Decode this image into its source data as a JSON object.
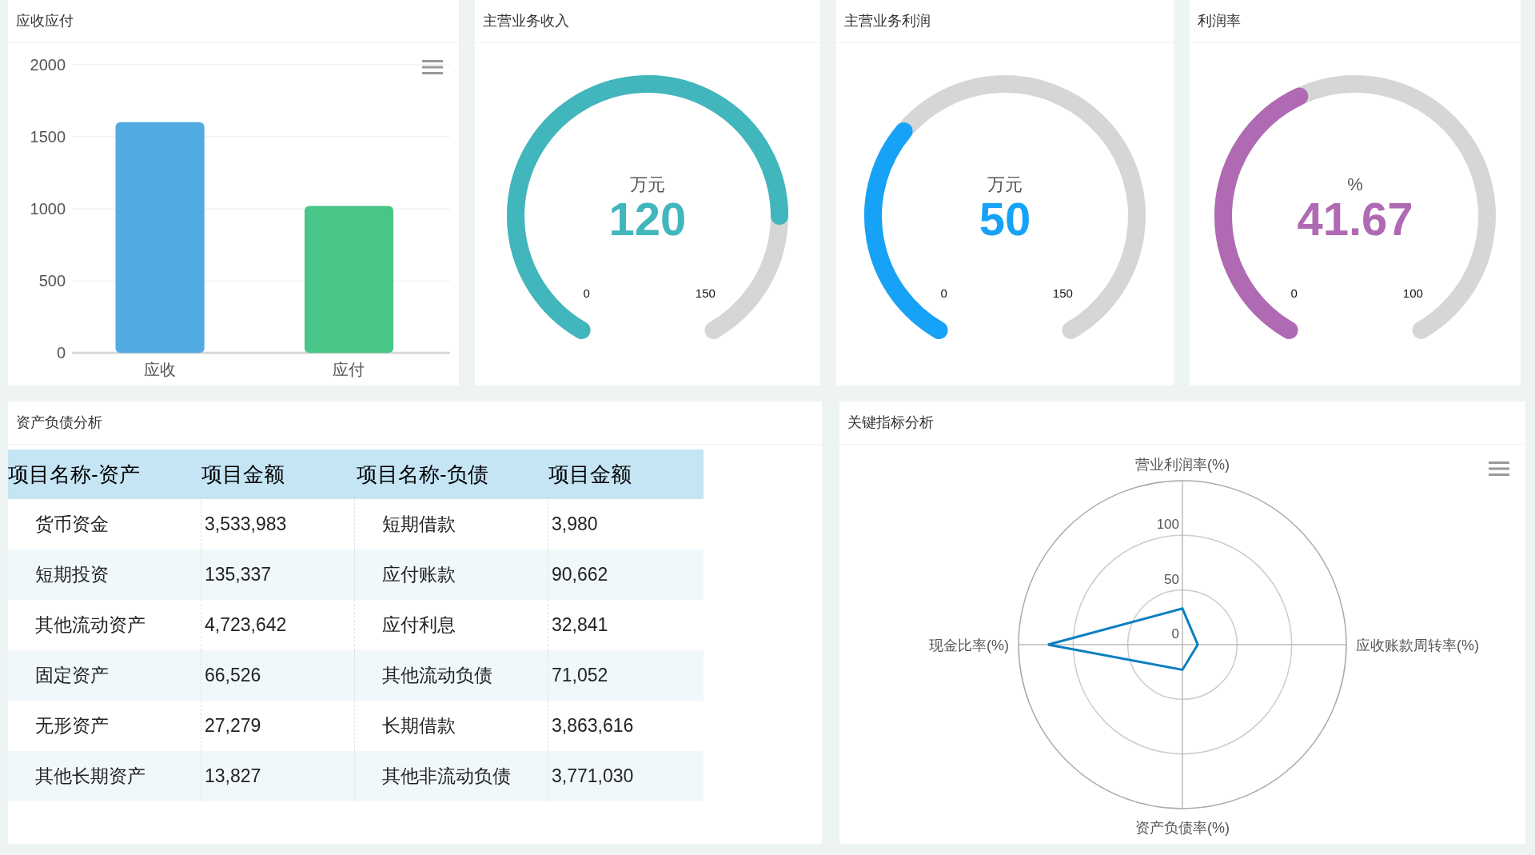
{
  "receivables_card": {
    "title": "应收应付",
    "chart_data": {
      "type": "bar",
      "categories": [
        "应收",
        "应付"
      ],
      "values": [
        1600,
        1020
      ],
      "ylim": [
        0,
        2000
      ],
      "yticks": [
        0,
        500,
        1000,
        1500,
        2000
      ],
      "grid": true
    }
  },
  "gauges": [
    {
      "title": "主营业务收入",
      "unit": "万元",
      "value": "120",
      "min_label": "0",
      "max_label": "150",
      "color": "#41b6bc"
    },
    {
      "title": "主营业务利润",
      "unit": "万元",
      "value": "50",
      "min_label": "0",
      "max_label": "150",
      "color": "#16a2f7"
    },
    {
      "title": "利润率",
      "unit": "%",
      "value": "41.67",
      "min_label": "0",
      "max_label": "100",
      "color": "#b06ab3"
    }
  ],
  "balance_table": {
    "title": "资产负债分析",
    "columns": [
      "项目名称-资产",
      "项目金额",
      "项目名称-负债",
      "项目金额"
    ],
    "rows": [
      [
        "货币资金",
        "3,533,983",
        "短期借款",
        "3,980"
      ],
      [
        "短期投资",
        "135,337",
        "应付账款",
        "90,662"
      ],
      [
        "其他流动资产",
        "4,723,642",
        "应付利息",
        "32,841"
      ],
      [
        "固定资产",
        "66,526",
        "其他流动负债",
        "71,052"
      ],
      [
        "无形资产",
        "27,279",
        "长期借款",
        "3,863,616"
      ],
      [
        "其他长期资产",
        "13,827",
        "其他非流动负债",
        "3,771,030"
      ]
    ]
  },
  "key_indicators": {
    "title": "关键指标分析",
    "chart_data": {
      "type": "radar",
      "categories": [
        "营业利润率(%)",
        "应收账款周转率(%)",
        "资产负债率(%)",
        "现金比率(%)"
      ],
      "values": [
        33,
        14,
        23,
        123
      ],
      "ylim": [
        0,
        150
      ],
      "yticks": [
        0,
        50,
        100
      ]
    }
  }
}
